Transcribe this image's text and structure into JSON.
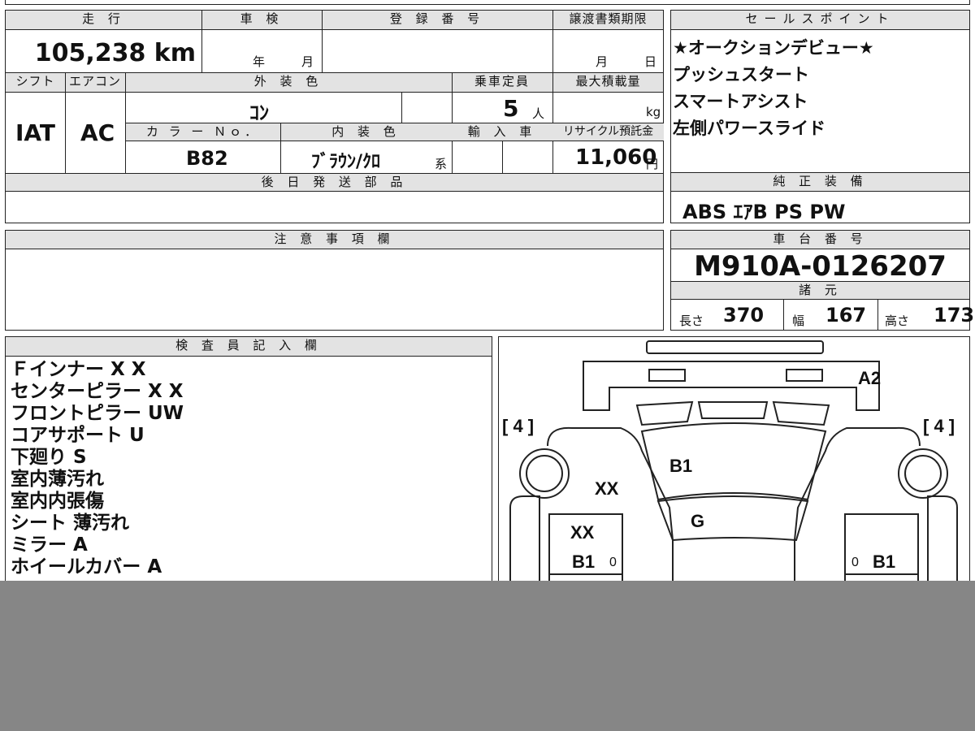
{
  "vehicle": {
    "mileage": {
      "label": "走 行",
      "value": "105,238 km"
    },
    "inspection": {
      "label": "車 検",
      "year_unit": "年",
      "month_unit": "月"
    },
    "registration": {
      "label": "登 録 番 号"
    },
    "transfer_deadline": {
      "label": "譲渡書類期限",
      "month_unit": "月",
      "day_unit": "日"
    },
    "shift": {
      "label": "シフト",
      "value": "IAT"
    },
    "aircon": {
      "label": "エアコン",
      "value": "AC"
    },
    "exterior_color": {
      "label": "外 装 色",
      "value": "ｺﾝ"
    },
    "capacity": {
      "label": "乗車定員",
      "value": "5",
      "unit": "人"
    },
    "max_load": {
      "label": "最大積載量",
      "unit": "kg"
    },
    "color_no": {
      "label": "カ ラ ー Ｎｏ．",
      "value": "B82"
    },
    "interior_color": {
      "label": "内 装 色",
      "value": "ﾌﾞﾗｳﾝ/ｸﾛ",
      "suffix": "系"
    },
    "imported": {
      "label": "輸 入 車"
    },
    "recycle_fee": {
      "label": "リサイクル預託金",
      "value": "11,060",
      "unit": "円"
    },
    "later_parts": {
      "label": "後 日 発 送 部 品"
    }
  },
  "sales_points": {
    "label": "セールスポイント",
    "items": [
      "★オークションデビュー★",
      "プッシュスタート",
      "スマートアシスト",
      "左側パワースライド"
    ]
  },
  "standard_equipment": {
    "label": "純 正 装 備",
    "value": "ABS ｴｱB PS PW"
  },
  "notes": {
    "label": "注 意 事 項 欄"
  },
  "chassis": {
    "label": "車 台 番 号",
    "value": "M910A-0126207"
  },
  "specs": {
    "label": "諸 元",
    "length": {
      "label": "長さ",
      "value": "370"
    },
    "width": {
      "label": "幅",
      "value": "167"
    },
    "height": {
      "label": "高さ",
      "value": "173"
    }
  },
  "inspector": {
    "label": "検 査 員 記 入 欄",
    "lines": [
      "Ｆインナー X X",
      "センターピラー X X",
      "フロントピラー UW",
      "コアサポート U",
      "下廻り S",
      "室内薄汚れ",
      "室内内張傷",
      "シート 薄汚れ",
      "ミラー A",
      "ホイールカバー A"
    ]
  },
  "diagram": {
    "bracket_left": "[ 4 ]",
    "bracket_right": "[ 4 ]",
    "marks": [
      "A2",
      "B1",
      "XX",
      "G",
      "XX",
      "B1",
      "0",
      "0",
      "B1"
    ]
  },
  "colors": {
    "header_bg": "#e3e3e3",
    "overlay": "#868686"
  }
}
